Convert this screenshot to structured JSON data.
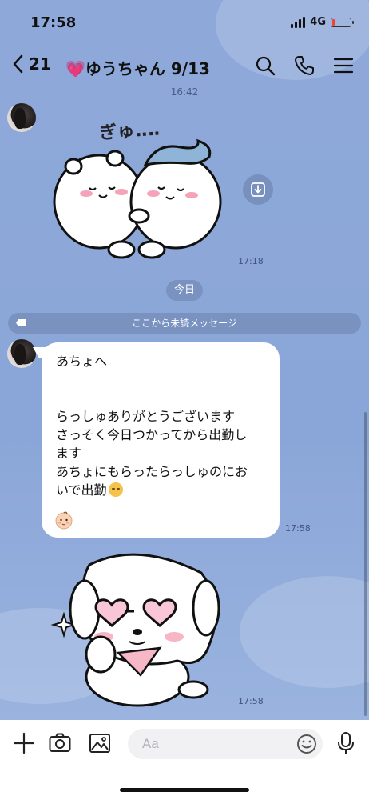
{
  "status_bar": {
    "time": "17:58",
    "network": "4G",
    "battery_level": 0.1
  },
  "header": {
    "back_count": "21",
    "title": "💗ゆうちゃん 9/13",
    "icons": [
      "search-icon",
      "phone-icon",
      "menu-icon"
    ]
  },
  "messages": {
    "top_time": "16:42",
    "sticker1_text": "ぎゅ‥‥",
    "sticker1_time": "17:18",
    "date_divider": "今日",
    "unread_divider": "ここから未読メッセージ",
    "text_lines": [
      "あちょへ",
      "",
      "",
      "らっしゅありがとうございます",
      "さっそく今日つかってから出勤し",
      "ます",
      "あちょにもらったらっしゅのにお",
      "いで出勤"
    ],
    "text_time": "17:58",
    "sticker2_time": "17:58"
  },
  "input_bar": {
    "placeholder": "Aa"
  },
  "colors": {
    "chat_background": "#8ea9d9",
    "bubble": "#ffffff",
    "accent_pink": "#f060a8"
  }
}
